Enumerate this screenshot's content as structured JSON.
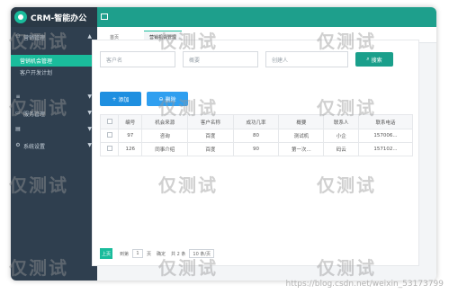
{
  "app": {
    "title": "CRM-智能办公"
  },
  "sidebar": {
    "groups": [
      {
        "label": "营销管理",
        "icon": "user-icon"
      },
      {
        "label": "服务管理",
        "icon": "monitor-icon"
      },
      {
        "label": "系统设置",
        "icon": "gear-icon"
      }
    ],
    "subs": [
      {
        "label": "营销机会管理",
        "active": true
      },
      {
        "label": "客户开发计划",
        "active": false
      }
    ]
  },
  "tabs": [
    {
      "label": "首页"
    },
    {
      "label": "营销机会管理"
    }
  ],
  "search": {
    "customer_placeholder": "客户名",
    "summary_placeholder": "概要",
    "creator_placeholder": "创建人",
    "button_label": "搜索"
  },
  "toolbar": {
    "add_label": "添加",
    "delete_label": "删除"
  },
  "table": {
    "headers": [
      "编号",
      "机会来源",
      "客户名称",
      "成功几率",
      "概要",
      "联系人",
      "联系电话"
    ],
    "rows": [
      [
        "97",
        "咨询",
        "百度",
        "80",
        "测试机",
        "小企",
        "157006..."
      ],
      [
        "126",
        "同事介绍",
        "百度",
        "90",
        "第一次...",
        "码云",
        "157102..."
      ]
    ]
  },
  "pager": {
    "prev_label": "上页",
    "page_prefix": "到第",
    "page_value": "1",
    "page_suffix": "页",
    "confirm_label": "确定",
    "total_label": "共 2 条",
    "size_label": "10 条/页"
  },
  "watermark": {
    "text": "仅测试"
  },
  "footer": {
    "url": "https://blog.csdn.net/weixin_53173799"
  },
  "colors": {
    "accent": "#1abc9c",
    "sidebar": "#2f3f4f",
    "topbar": "#1e9f8c",
    "primary": "#1e8fe0"
  }
}
